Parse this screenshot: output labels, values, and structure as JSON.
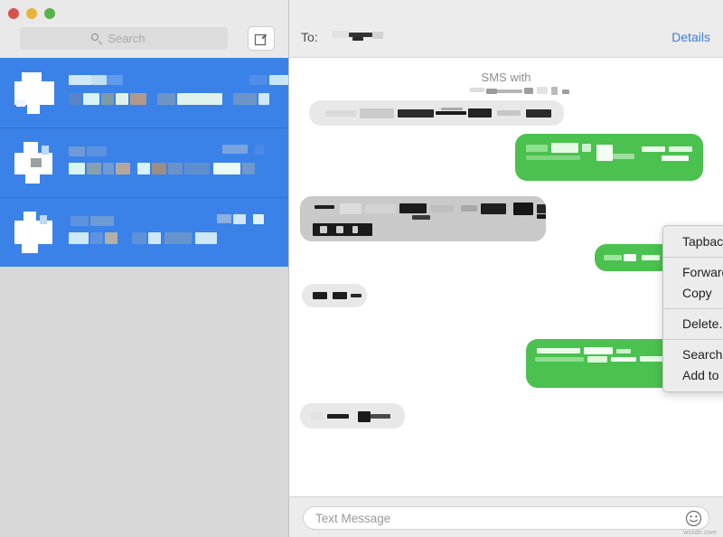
{
  "window": {
    "traffic_lights": [
      {
        "name": "close",
        "color": "#d6524d"
      },
      {
        "name": "minimize",
        "color": "#e6b23d"
      },
      {
        "name": "maximize",
        "color": "#59b34c"
      }
    ]
  },
  "sidebar": {
    "search": {
      "placeholder": "Search",
      "value": "",
      "icon": "search-icon"
    },
    "compose": {
      "icon": "compose-icon",
      "label": ""
    },
    "conversations": [
      {
        "selected": true,
        "name_redacted": true,
        "preview_redacted": true,
        "timestamp_redacted": true
      },
      {
        "selected": true,
        "name_redacted": true,
        "preview_redacted": true,
        "timestamp_redacted": true
      },
      {
        "selected": true,
        "name_redacted": true,
        "preview_redacted": true,
        "timestamp_redacted": true
      }
    ]
  },
  "conversation": {
    "to_label": "To:",
    "recipient_redacted": true,
    "details_link": "Details",
    "sms_with": "SMS with",
    "sms_with_name_redacted": true,
    "messages": [
      {
        "id": "m1",
        "side": "received",
        "redacted": true,
        "selected": false
      },
      {
        "id": "m2",
        "side": "sent",
        "redacted": true,
        "selected": false
      },
      {
        "id": "m3",
        "side": "received",
        "redacted": true,
        "selected": true
      },
      {
        "id": "m4",
        "side": "sent",
        "redacted": true,
        "selected": false
      },
      {
        "id": "m5",
        "side": "received",
        "redacted": true,
        "selected": false
      },
      {
        "id": "m6",
        "side": "sent",
        "redacted": true,
        "selected": false
      },
      {
        "id": "m7",
        "side": "received",
        "redacted": true,
        "selected": false
      }
    ]
  },
  "context_menu": {
    "groups": [
      [
        "Tapback..."
      ],
      [
        "Forward...",
        "Copy"
      ],
      [
        "Delete..."
      ],
      [
        "Search With Google",
        "Add to iTunes as a Spoken Track"
      ]
    ]
  },
  "composer": {
    "placeholder": "Text Message",
    "value": "",
    "emoji_icon": "smiley-icon"
  },
  "watermark": "wsxdn.com",
  "colors": {
    "selection_blue": "#3b82e8",
    "sent_bubble_green": "#4bc14f",
    "received_bubble_gray": "#e8e8e8",
    "received_bubble_selected_gray": "#c9c9c9",
    "link_blue": "#3f7fd0",
    "toolbar_gray": "#ececec",
    "sidebar_empty_gray": "#d8d8d8"
  }
}
